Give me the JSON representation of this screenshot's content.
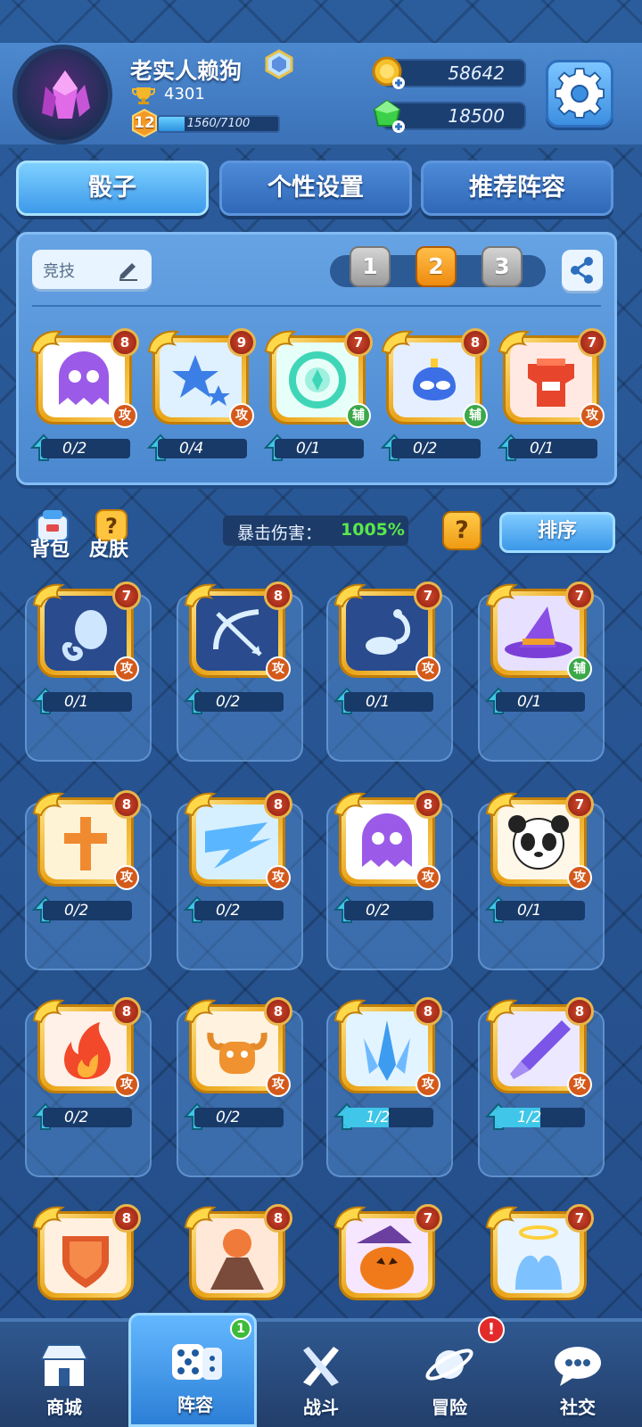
{
  "player": {
    "name": "老实人赖狗",
    "trophies": "4301",
    "level": "12",
    "xp_text": "1560/7100",
    "xp_progress": 0.22
  },
  "currency": {
    "gold": "58642",
    "gems": "18500"
  },
  "tabs": [
    {
      "label": "骰子",
      "active": true
    },
    {
      "label": "个性设置",
      "active": false
    },
    {
      "label": "推荐阵容",
      "active": false
    }
  ],
  "deck": {
    "mode_label": "竞技",
    "slots": [
      "1",
      "2",
      "3"
    ],
    "selected_slot": "2",
    "cards": [
      {
        "icon": "ghost",
        "level": "8",
        "role": "攻",
        "progress": "0/2",
        "fill": 0
      },
      {
        "icon": "stars",
        "level": "9",
        "role": "攻",
        "progress": "0/4",
        "fill": 0
      },
      {
        "icon": "portal",
        "level": "7",
        "role": "辅",
        "progress": "0/1",
        "fill": 0
      },
      {
        "icon": "mask",
        "level": "8",
        "role": "辅",
        "progress": "0/2",
        "fill": 0
      },
      {
        "icon": "armor",
        "level": "7",
        "role": "攻",
        "progress": "0/1",
        "fill": 0
      }
    ]
  },
  "collection": {
    "bag_label": "背包",
    "skin_label": "皮肤",
    "crit_label": "暴击伤害：",
    "crit_value": "1005%",
    "help_label": "?",
    "sort_label": "排序",
    "cards": [
      {
        "icon": "aquarius",
        "level": "7",
        "role": "攻",
        "progress": "0/1",
        "fill": 0
      },
      {
        "icon": "sagittarius",
        "level": "8",
        "role": "攻",
        "progress": "0/2",
        "fill": 0
      },
      {
        "icon": "scorpio",
        "level": "7",
        "role": "攻",
        "progress": "0/1",
        "fill": 0
      },
      {
        "icon": "witch-hat",
        "level": "7",
        "role": "辅",
        "progress": "0/1",
        "fill": 0
      },
      {
        "icon": "holy-cross",
        "level": "8",
        "role": "攻",
        "progress": "0/2",
        "fill": 0
      },
      {
        "icon": "lightning",
        "level": "8",
        "role": "攻",
        "progress": "0/2",
        "fill": 0
      },
      {
        "icon": "ghost",
        "level": "8",
        "role": "攻",
        "progress": "0/2",
        "fill": 0
      },
      {
        "icon": "panda",
        "level": "7",
        "role": "攻",
        "progress": "0/1",
        "fill": 0
      },
      {
        "icon": "fire",
        "level": "8",
        "role": "攻",
        "progress": "0/2",
        "fill": 0
      },
      {
        "icon": "bull",
        "level": "8",
        "role": "攻",
        "progress": "0/2",
        "fill": 0
      },
      {
        "icon": "ice-spike",
        "level": "8",
        "role": "攻",
        "progress": "1/2",
        "fill": 0.5
      },
      {
        "icon": "wind-blade",
        "level": "8",
        "role": "攻",
        "progress": "1/2",
        "fill": 0.5
      },
      {
        "icon": "shield",
        "level": "8",
        "role": "",
        "progress": "",
        "fill": 0
      },
      {
        "icon": "volcano",
        "level": "8",
        "role": "",
        "progress": "",
        "fill": 0
      },
      {
        "icon": "pumpkin",
        "level": "7",
        "role": "",
        "progress": "",
        "fill": 0
      },
      {
        "icon": "angel",
        "level": "7",
        "role": "",
        "progress": "",
        "fill": 0
      }
    ]
  },
  "nav": [
    {
      "label": "商城",
      "icon": "shop-icon",
      "active": false,
      "badge": ""
    },
    {
      "label": "阵容",
      "icon": "dice-icon",
      "active": true,
      "badge": "1"
    },
    {
      "label": "战斗",
      "icon": "swords-icon",
      "active": false,
      "badge": ""
    },
    {
      "label": "冒险",
      "icon": "planet-icon",
      "active": false,
      "badge": "!"
    },
    {
      "label": "社交",
      "icon": "chat-icon",
      "active": false,
      "badge": ""
    }
  ],
  "colors": {
    "background": "#27538f",
    "accent": "#3d99ea",
    "gold": "#f09a12",
    "crit_value": "#59e84a",
    "attack_role": "#d45a1c",
    "support_role": "#3ba84a"
  }
}
